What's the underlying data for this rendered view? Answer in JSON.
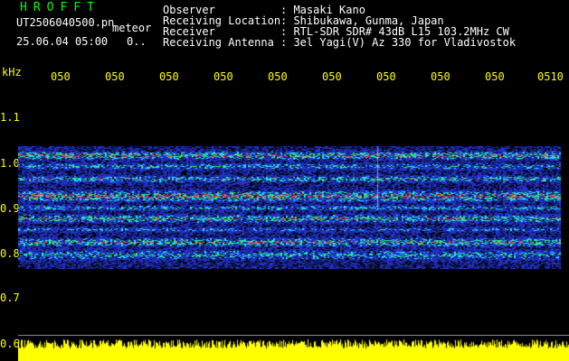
{
  "header": {
    "title": "HROFFT",
    "filename": "UT2506040500.pn",
    "mode": "meteor",
    "datetime": "25.06.04 05:00",
    "flag": "0.."
  },
  "info": [
    {
      "label": "Observer",
      "value": ": Masaki Kano"
    },
    {
      "label": "Receiving Location",
      "value": ": Shibukawa, Gunma, Japan"
    },
    {
      "label": "Receiver",
      "value": ": RTL-SDR SDR# 43dB L15 103.2MHz CW"
    },
    {
      "label": "Receiving Antenna",
      "value": ": 3el Yagi(V) Az 330 for Vladivostok"
    }
  ],
  "axis": {
    "unit": "kHz",
    "y_ticks": [
      "1.1",
      "1.0",
      "0.9",
      "0.8",
      "0.7",
      "0.6"
    ],
    "x_ticks": [
      "050",
      "050",
      "050",
      "050",
      "050",
      "050",
      "050",
      "050",
      "050",
      "0510"
    ]
  },
  "colors": {
    "label_yellow": "#ffff00",
    "title_green": "#00ff00",
    "text_white": "#ffffff",
    "signal_blue": "#2233cc",
    "signal_cyan": "#22ddff",
    "signal_green": "#22ff66",
    "signal_red": "#ff3333"
  }
}
